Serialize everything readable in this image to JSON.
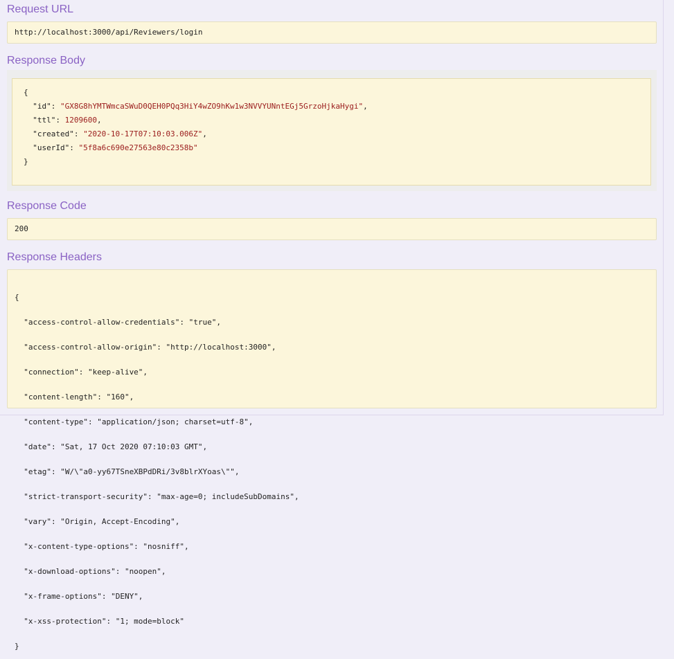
{
  "request_url": {
    "heading": "Request URL",
    "value": "http://localhost:3000/api/Reviewers/login"
  },
  "response_body": {
    "heading": "Response Body",
    "open_brace": "{",
    "close_brace": "}",
    "fields": [
      {
        "key": "\"id\"",
        "value": "\"GX8G8hYMTWmcaSWuD0QEH0PQq3HiY4wZO9hKw1w3NVVYUNntEGj5GrzoHjkaHygi\"",
        "suffix": ","
      },
      {
        "key": "\"ttl\"",
        "value": "1209600",
        "suffix": ","
      },
      {
        "key": "\"created\"",
        "value": "\"2020-10-17T07:10:03.006Z\"",
        "suffix": ","
      },
      {
        "key": "\"userId\"",
        "value": "\"5f8a6c690e27563e80c2358b\"",
        "suffix": ""
      }
    ]
  },
  "response_code": {
    "heading": "Response Code",
    "value": "200"
  },
  "response_headers": {
    "heading": "Response Headers",
    "lines": [
      "{",
      "  \"access-control-allow-credentials\": \"true\",",
      "  \"access-control-allow-origin\": \"http://localhost:3000\",",
      "  \"connection\": \"keep-alive\",",
      "  \"content-length\": \"160\",",
      "  \"content-type\": \"application/json; charset=utf-8\",",
      "  \"date\": \"Sat, 17 Oct 2020 07:10:03 GMT\",",
      "  \"etag\": \"W/\\\"a0-yy67TSneXBPdDRi/3v8blrXYoas\\\"\",",
      "  \"strict-transport-security\": \"max-age=0; includeSubDomains\",",
      "  \"vary\": \"Origin, Accept-Encoding\",",
      "  \"x-content-type-options\": \"nosniff\",",
      "  \"x-download-options\": \"noopen\",",
      "  \"x-frame-options\": \"DENY\",",
      "  \"x-xss-protection\": \"1; mode=block\"",
      "}"
    ]
  },
  "colors": {
    "heading": "#8a62c4",
    "box_background": "#fcf6db",
    "string_value": "#9a1b1b",
    "page_background": "#f0eef8"
  }
}
